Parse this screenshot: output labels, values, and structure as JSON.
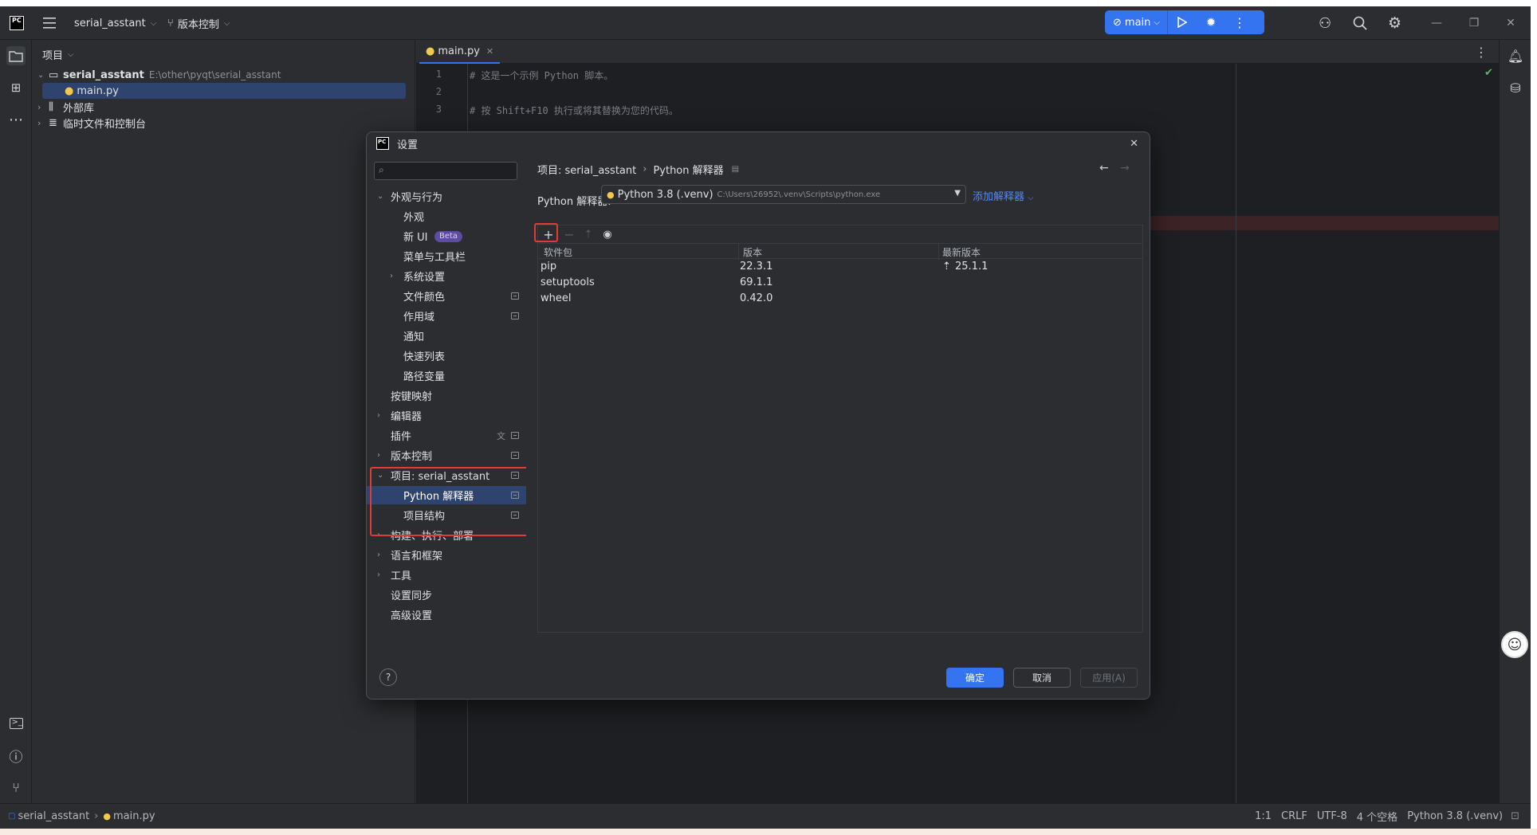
{
  "titlebar": {
    "project_name": "serial_asstant",
    "vcs_label": "版本控制",
    "branch": "main"
  },
  "project_panel": {
    "header": "项目",
    "tree": [
      {
        "label": "serial_asstant",
        "path": "E:\\other\\pyqt\\serial_asstant"
      },
      {
        "label": "main.py"
      },
      {
        "label": "外部库"
      },
      {
        "label": "临时文件和控制台"
      }
    ]
  },
  "editor": {
    "tab_label": "main.py",
    "lines": [
      {
        "num": "1",
        "text": "# 这是一个示例 Python 脚本。"
      },
      {
        "num": "2",
        "text": ""
      },
      {
        "num": "3",
        "text": "# 按 Shift+F10 执行或将其替换为您的代码。"
      }
    ]
  },
  "dialog": {
    "title": "设置",
    "breadcrumb": {
      "project": "项目: serial_asstant",
      "page": "Python 解释器"
    },
    "nav": [
      {
        "label": "外观与行为"
      },
      {
        "label": "外观"
      },
      {
        "label": "新 UI",
        "badge": "Beta"
      },
      {
        "label": "菜单与工具栏"
      },
      {
        "label": "系统设置"
      },
      {
        "label": "文件颜色"
      },
      {
        "label": "作用域"
      },
      {
        "label": "通知"
      },
      {
        "label": "快速列表"
      },
      {
        "label": "路径变量"
      },
      {
        "label": "按键映射"
      },
      {
        "label": "编辑器"
      },
      {
        "label": "插件"
      },
      {
        "label": "版本控制"
      },
      {
        "label": "项目: serial_asstant"
      },
      {
        "label": "Python 解释器"
      },
      {
        "label": "项目结构"
      },
      {
        "label": "构建、执行、部署"
      },
      {
        "label": "语言和框架"
      },
      {
        "label": "工具"
      },
      {
        "label": "设置同步"
      },
      {
        "label": "高级设置"
      }
    ],
    "interpreter": {
      "label": "Python 解释器:",
      "name": "Python 3.8 (.venv)",
      "path": "C:\\Users\\26952\\.venv\\Scripts\\python.exe",
      "add_label": "添加解释器"
    },
    "table": {
      "headers": [
        "软件包",
        "版本",
        "最新版本"
      ],
      "rows": [
        {
          "package": "pip",
          "version": "22.3.1",
          "latest": "25.1.1"
        },
        {
          "package": "setuptools",
          "version": "69.1.1",
          "latest": ""
        },
        {
          "package": "wheel",
          "version": "0.42.0",
          "latest": ""
        }
      ]
    },
    "buttons": {
      "ok": "确定",
      "cancel": "取消",
      "apply": "应用(A)"
    },
    "help": "?"
  },
  "statusbar": {
    "crumb_project": "serial_asstant",
    "crumb_file": "main.py",
    "position": "1:1",
    "line_sep": "CRLF",
    "encoding": "UTF-8",
    "indent": "4 个空格",
    "interpreter": "Python 3.8 (.venv)"
  },
  "colors": {
    "accent": "#3574f0",
    "highlight": "#e53935"
  }
}
